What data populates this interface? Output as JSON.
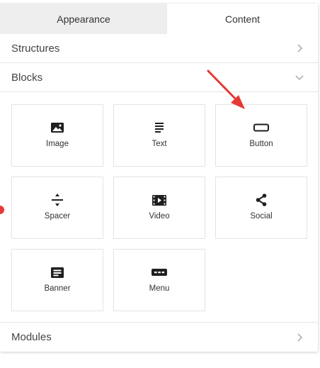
{
  "tabs": [
    {
      "label": "Appearance",
      "active": false
    },
    {
      "label": "Content",
      "active": true
    }
  ],
  "sections": {
    "structures": {
      "label": "Structures",
      "expanded": false
    },
    "blocks": {
      "label": "Blocks",
      "expanded": true
    },
    "modules": {
      "label": "Modules",
      "expanded": false
    }
  },
  "blocks": [
    {
      "label": "Image",
      "icon": "image-icon"
    },
    {
      "label": "Text",
      "icon": "text-icon"
    },
    {
      "label": "Button",
      "icon": "button-icon"
    },
    {
      "label": "Spacer",
      "icon": "spacer-icon"
    },
    {
      "label": "Video",
      "icon": "video-icon"
    },
    {
      "label": "Social",
      "icon": "share-icon"
    },
    {
      "label": "Banner",
      "icon": "banner-icon"
    },
    {
      "label": "Menu",
      "icon": "menu-icon"
    }
  ],
  "colors": {
    "annotation": "#e53935",
    "inactive_tab_bg": "#eeeeee",
    "icon": "#1f1f1f"
  }
}
